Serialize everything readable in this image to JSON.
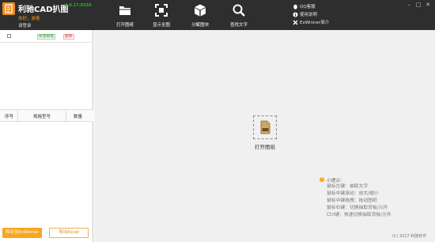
{
  "app": {
    "title": "利驰CAD扒图",
    "version": "4.0.17.0316",
    "greeting": "你好，游客",
    "login": "请登录"
  },
  "toolbar": [
    {
      "label": "打开图纸",
      "icon": "folder-icon"
    },
    {
      "label": "显示全图",
      "icon": "fit-view-icon"
    },
    {
      "label": "分解图块",
      "icon": "cube-icon"
    },
    {
      "label": "查找文字",
      "icon": "magnifier-icon"
    }
  ],
  "links": {
    "qq_service": "QQ客服",
    "user_guide": "使用说明",
    "exwinner_intro": "ExWinner简介"
  },
  "left_panel": {
    "new_group": "新建框框",
    "delete": "删除",
    "columns": [
      "序号",
      "规格型号",
      "数量"
    ],
    "export_exwinner": "导出至ExWinner",
    "export_excel": "导出Excel"
  },
  "canvas": {
    "open_drawing": "打开图纸",
    "tips_title": "小提示：",
    "tips": [
      "鼠标左键：抽取文字",
      "鼠标中键滚动：放大/缩小",
      "鼠标中键拖拽：拖动图纸",
      "鼠标右键：切换抽取背板/元件",
      "Ctrl键：快速切换抽取背板/元件"
    ],
    "copyright": "(C) 2017 利驰软件"
  },
  "colors": {
    "topbar": "#2e2e2e",
    "accent_orange": "#f5a623",
    "version_green": "#2ab52a",
    "canvas_bg": "#f0f0f0"
  }
}
